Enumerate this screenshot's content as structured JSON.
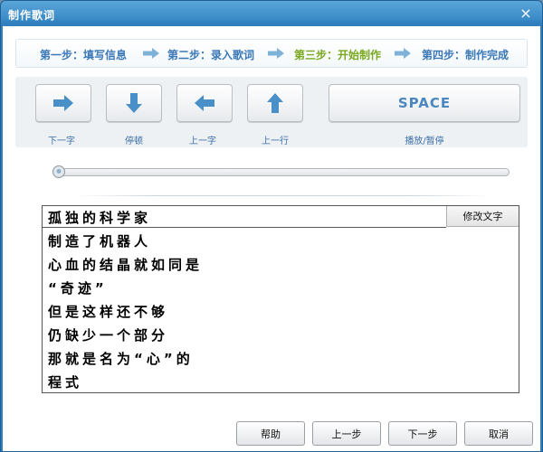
{
  "window": {
    "title": "制作歌词",
    "close_glyph": "×"
  },
  "steps": [
    {
      "label": "第一步：填写信息",
      "active": false
    },
    {
      "label": "第二步：录入歌词",
      "active": false
    },
    {
      "label": "第三步：开始制作",
      "active": true
    },
    {
      "label": "第四步：制作完成",
      "active": false
    }
  ],
  "controls": [
    {
      "label": "下一字",
      "icon": "arrow-right-icon"
    },
    {
      "label": "停顿",
      "icon": "arrow-down-icon"
    },
    {
      "label": "上一字",
      "icon": "arrow-left-icon"
    },
    {
      "label": "上一行",
      "icon": "arrow-up-icon"
    }
  ],
  "space": {
    "key": "SPACE",
    "label": "播放/暂停"
  },
  "slider": {
    "position": 0
  },
  "lyrics": {
    "edit_button": "修改文字",
    "lines": [
      "孤独的科学家",
      "制造了机器人",
      "心血的结晶就如同是",
      "“奇迹”",
      "但是这样还不够",
      "仍缺少一个部分",
      "那就是名为“心”的",
      "程式"
    ]
  },
  "footer": {
    "help": "帮助",
    "prev": "上一步",
    "next": "下一步",
    "cancel": "取消"
  },
  "colors": {
    "accent": "#3a78b8",
    "active_step": "#7aa820",
    "arrow_icon": "#4a90c8"
  }
}
